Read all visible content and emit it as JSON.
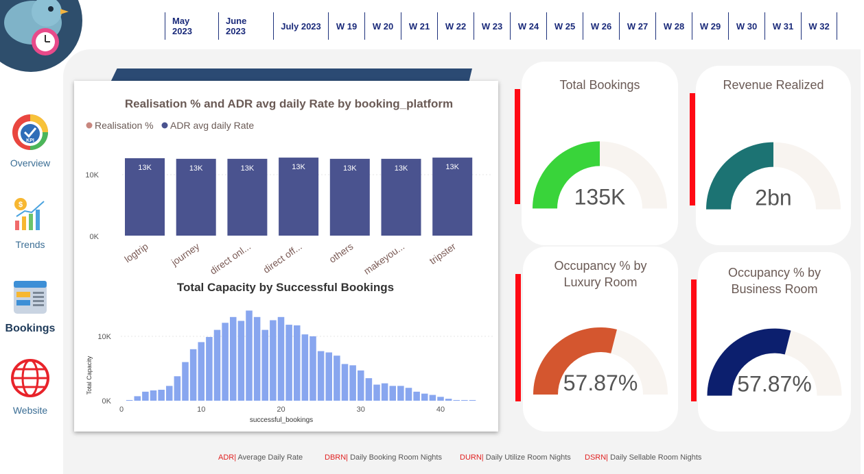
{
  "date_filters": [
    "May 2023",
    "June 2023",
    "July 2023",
    "W 19",
    "W 20",
    "W 21",
    "W 22",
    "W 23",
    "W 24",
    "W 25",
    "W 26",
    "W 27",
    "W 28",
    "W 29",
    "W 30",
    "W 31",
    "W 32"
  ],
  "nav": [
    {
      "label": "Overview",
      "icon": "kpi-icon"
    },
    {
      "label": "Trends",
      "icon": "trends-icon"
    },
    {
      "label": "Bookings",
      "icon": "bookings-icon",
      "active": true
    },
    {
      "label": "Website",
      "icon": "globe-icon"
    }
  ],
  "chart_data": [
    {
      "type": "bar",
      "title": "Realisation % and ADR avg daily Rate by booking_platform",
      "legend": [
        "Realisation %",
        "ADR avg daily Rate"
      ],
      "legend_colors": [
        "#c8877f",
        "#4a538f"
      ],
      "categories": [
        "logtrip",
        "journey",
        "direct onl...",
        "direct off...",
        "others",
        "makeyou...",
        "tripster"
      ],
      "series": [
        {
          "name": "ADR avg daily Rate",
          "values": [
            12700,
            12600,
            12600,
            12800,
            12600,
            12600,
            12800
          ],
          "labels": [
            "13K",
            "13K",
            "13K",
            "13K",
            "13K",
            "13K",
            "13K"
          ]
        }
      ],
      "y_ticks": [
        "0K",
        "10K"
      ],
      "ylim": [
        0,
        14000
      ],
      "bar_color": "#4a538f"
    },
    {
      "type": "bar",
      "title": "Total Capacity by Successful Bookings",
      "xlabel": "successful_bookings",
      "ylabel": "Total Capacity",
      "x_ticks": [
        "0",
        "10",
        "20",
        "30",
        "40"
      ],
      "y_ticks": [
        "0K",
        "10K"
      ],
      "x": [
        1,
        2,
        3,
        4,
        5,
        6,
        7,
        8,
        9,
        10,
        11,
        12,
        13,
        14,
        15,
        16,
        17,
        18,
        19,
        20,
        21,
        22,
        23,
        24,
        25,
        26,
        27,
        28,
        29,
        30,
        31,
        32,
        33,
        34,
        35,
        36,
        37,
        38,
        39,
        40,
        41,
        42,
        43,
        44
      ],
      "values": [
        100,
        700,
        1400,
        1600,
        1700,
        2300,
        3800,
        6000,
        8000,
        9100,
        9900,
        11000,
        12100,
        13000,
        12400,
        14000,
        13000,
        11000,
        12500,
        13000,
        11800,
        11700,
        10300,
        10000,
        7700,
        7500,
        7000,
        5700,
        5500,
        4700,
        3500,
        2500,
        2700,
        2300,
        2300,
        2000,
        1400,
        1100,
        900,
        600,
        300,
        100,
        50,
        100
      ],
      "ylim": [
        0,
        15000
      ],
      "xlim": [
        0,
        44
      ],
      "bar_color": "#88a6ef"
    }
  ],
  "kpis": [
    {
      "title": "Total Bookings",
      "value": "135K",
      "fraction": 0.5,
      "color": "#39d43a"
    },
    {
      "title": "Revenue Realized",
      "value": "2bn",
      "fraction": 0.5,
      "color": "#1c7373"
    },
    {
      "title": "Occupancy % by Luxury Room",
      "value": "57.87%",
      "fraction": 0.5787,
      "color": "#d4562f"
    },
    {
      "title": "Occupancy % by Business Room",
      "value": "57.87%",
      "fraction": 0.5787,
      "color": "#0c1f6e"
    }
  ],
  "kpi_track_color": "#f8f4f0",
  "footer": [
    {
      "key": "ADR|",
      "text": "Average Daily Rate"
    },
    {
      "key": "DBRN|",
      "text": "Daily Booking Room Nights"
    },
    {
      "key": "DURN|",
      "text": "Daily Utilize Room Nights"
    },
    {
      "key": "DSRN|",
      "text": "Daily Sellable Room Nights"
    }
  ]
}
